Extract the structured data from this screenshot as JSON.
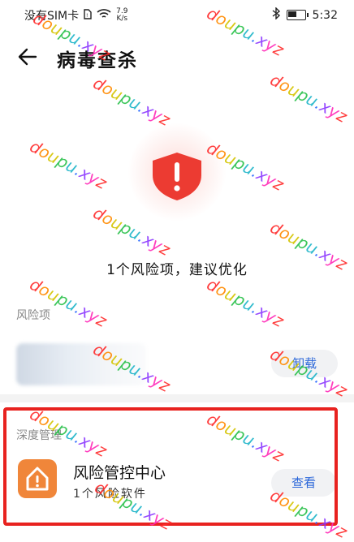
{
  "status_bar": {
    "carrier": "没有SIM卡",
    "net_speed_value": "7.9",
    "net_speed_unit": "K/s",
    "time": "5:32",
    "battery_level": 0.5
  },
  "header": {
    "title": "病毒查杀"
  },
  "scan": {
    "summary": "1个风险项，建议优化"
  },
  "risk_section": {
    "label": "风险项",
    "uninstall_label": "卸载"
  },
  "deep_section": {
    "label": "深度管理",
    "app_name": "风险管控中心",
    "app_sub": "1个风险软件",
    "view_label": "查看"
  },
  "watermark": {
    "text": "doupu.xyz"
  },
  "colors": {
    "accent": "#2a66d9",
    "danger": "#e8221f",
    "app_icon": "#f0863a"
  }
}
